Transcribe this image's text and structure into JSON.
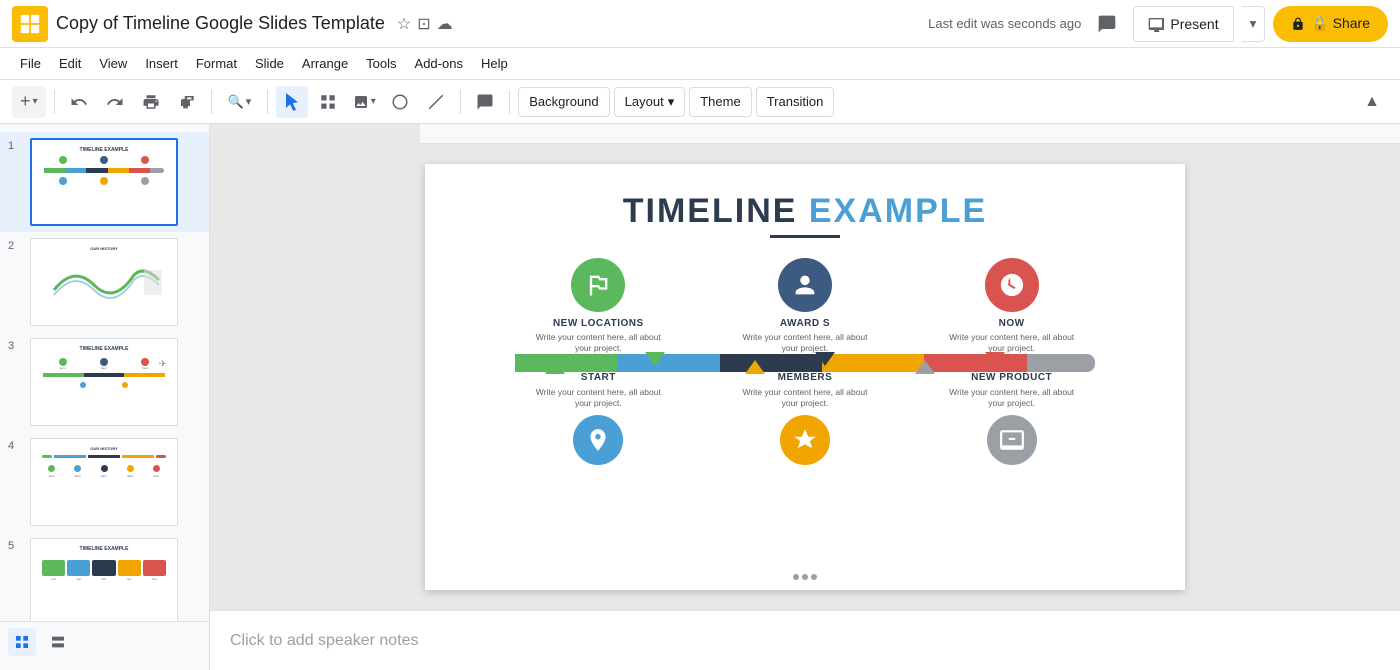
{
  "app": {
    "logo_char": "G",
    "title": "Copy of Timeline Google Slides Template",
    "last_edit": "Last edit was seconds ago"
  },
  "menu": {
    "items": [
      "File",
      "Edit",
      "View",
      "Insert",
      "Format",
      "Slide",
      "Arrange",
      "Tools",
      "Add-ons",
      "Help"
    ]
  },
  "toolbar": {
    "background_label": "Background",
    "layout_label": "Layout",
    "theme_label": "Theme",
    "transition_label": "Transition"
  },
  "header": {
    "present_label": "Present",
    "share_label": "🔒 Share"
  },
  "slides": [
    {
      "num": "1",
      "active": true,
      "label": "Slide 1 - Timeline Example"
    },
    {
      "num": "2",
      "active": false,
      "label": "Slide 2 - Our History"
    },
    {
      "num": "3",
      "active": false,
      "label": "Slide 3 - Timeline Example 2"
    },
    {
      "num": "4",
      "active": false,
      "label": "Slide 4 - Our History 2"
    },
    {
      "num": "5",
      "active": false,
      "label": "Slide 5 - Timeline Example 3"
    }
  ],
  "main_slide": {
    "title_part1": "TIMELINE ",
    "title_part2": "EXAMPLE",
    "top_items": [
      {
        "id": "new-locations",
        "title": "NEW LOCATIONS",
        "desc": "Write your content here, all about your project.",
        "icon_color": "#5cb85c",
        "icon_char": "⚑"
      },
      {
        "id": "awards",
        "title": "AWARD S",
        "desc": "Write your content here, all about your project.",
        "icon_color": "#3d5a80",
        "icon_char": "👤"
      },
      {
        "id": "now",
        "title": "NOW",
        "desc": "Write your content here, all about your project.",
        "icon_color": "#d9534f",
        "icon_char": "🚀"
      }
    ],
    "bottom_items": [
      {
        "id": "start",
        "title": "START",
        "desc": "Write your content here, all about your project.",
        "icon_color": "#4a9fd4",
        "icon_char": "📍"
      },
      {
        "id": "members",
        "title": "MEMBERS",
        "desc": "Write your content here, all about your project.",
        "icon_color": "#f0a500",
        "icon_char": "◆"
      },
      {
        "id": "new-product",
        "title": "NEW PRODUCT",
        "desc": "Write your content here, all about your project.",
        "icon_color": "#9aa0a6",
        "icon_char": "🖥"
      }
    ]
  },
  "speaker_notes": {
    "placeholder": "Click to add speaker notes"
  },
  "colors": {
    "green": "#5cb85c",
    "blue": "#4a9fd4",
    "dark": "#2d3b4e",
    "orange": "#f0a500",
    "red": "#d9534f",
    "gray": "#9aa0a6",
    "accent": "#4a9fd4"
  }
}
